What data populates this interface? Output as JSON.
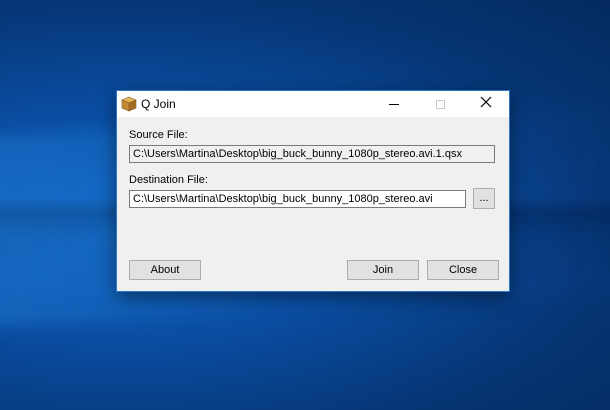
{
  "window": {
    "title": "Q Join"
  },
  "source": {
    "label": "Source File:",
    "value": "C:\\Users\\Martina\\Desktop\\big_buck_bunny_1080p_stereo.avi.1.qsx"
  },
  "destination": {
    "label": "Destination File:",
    "value": "C:\\Users\\Martina\\Desktop\\big_buck_bunny_1080p_stereo.avi",
    "browse_label": "..."
  },
  "buttons": {
    "about": "About",
    "join": "Join",
    "close": "Close"
  },
  "colors": {
    "window_border": "#2b78c9",
    "desktop_blue": "#0a4ea3",
    "dialog_background": "#f0f0f0"
  },
  "icons": {
    "app": "package-box-icon",
    "minimize": "minimize-icon",
    "maximize": "maximize-icon",
    "close": "close-icon"
  }
}
